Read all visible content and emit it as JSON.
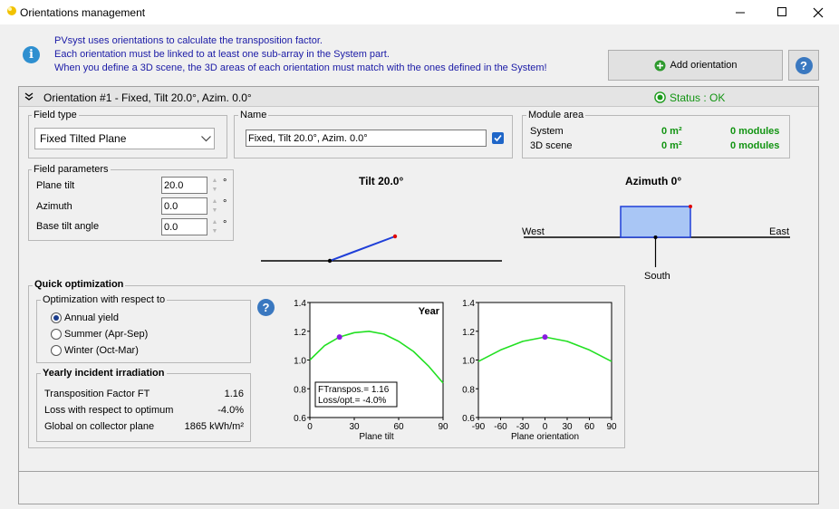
{
  "window": {
    "title": "Orientations management"
  },
  "info": {
    "lines": [
      "PVsyst uses orientations to calculate the transposition factor.",
      "Each orientation must be linked to at least one sub-array in the System part.",
      "When you define a 3D scene, the 3D areas of each orientation must match with the ones defined in the System!"
    ]
  },
  "toolbar": {
    "add_orientation": "Add orientation",
    "help": "?"
  },
  "orientation": {
    "header": "Orientation #1 - Fixed, Tilt 20.0°, Azim. 0.0°",
    "status": "Status : OK",
    "field_type": {
      "title": "Field type",
      "value": "Fixed Tilted Plane"
    },
    "name": {
      "title": "Name",
      "value": "Fixed, Tilt 20.0°, Azim. 0.0°",
      "checked": true
    },
    "module_area": {
      "title": "Module area",
      "rows": [
        {
          "label": "System",
          "area": "0 m²",
          "modules": "0 modules"
        },
        {
          "label": "3D scene",
          "area": "0 m²",
          "modules": "0 modules"
        }
      ]
    },
    "field_parameters": {
      "title": "Field parameters",
      "rows": [
        {
          "label": "Plane tilt",
          "value": "20.0",
          "unit": "°"
        },
        {
          "label": "Azimuth",
          "value": "0.0",
          "unit": "°"
        },
        {
          "label": "Base tilt angle",
          "value": "0.0",
          "unit": "°"
        }
      ]
    },
    "tilt_diagram": {
      "title": "Tilt 20.0°",
      "tilt_deg": 20
    },
    "azimuth_diagram": {
      "title": "Azimuth 0°",
      "west": "West",
      "east": "East",
      "south": "South"
    }
  },
  "quick_opt": {
    "title": "Quick optimization",
    "respect_title": "Optimization with respect to",
    "options": [
      {
        "label": "Annual yield",
        "selected": true
      },
      {
        "label": "Summer (Apr-Sep)",
        "selected": false
      },
      {
        "label": "Winter (Oct-Mar)",
        "selected": false
      }
    ],
    "yearly": {
      "title": "Yearly incident irradiation",
      "rows": [
        {
          "label": "Transposition Factor FT",
          "value": "1.16"
        },
        {
          "label": "Loss with respect to optimum",
          "value": "-4.0%"
        },
        {
          "label": "Global on collector plane",
          "value": "1865 kWh/m²"
        }
      ]
    },
    "help": "?"
  },
  "colors": {
    "curve": "#22e022",
    "point": "#8a1be0",
    "accent": "#129412",
    "tilt_line": "#1f3fd8",
    "panel_fill": "#a9c6f5"
  },
  "chart_data": [
    {
      "type": "line",
      "label": "Year",
      "xlabel": "Plane tilt",
      "ylabel": "",
      "xlim": [
        0,
        90
      ],
      "ylim": [
        0.6,
        1.4
      ],
      "xticks": [
        "0",
        "30",
        "60",
        "90"
      ],
      "yticks": [
        "0.6",
        "0.8",
        "1.0",
        "1.2",
        "1.4"
      ],
      "x": [
        0,
        10,
        20,
        30,
        40,
        50,
        60,
        70,
        80,
        90
      ],
      "values": [
        1.0,
        1.1,
        1.16,
        1.19,
        1.2,
        1.18,
        1.13,
        1.06,
        0.96,
        0.84
      ],
      "marker": {
        "x": 20,
        "y": 1.16
      },
      "annotation": [
        "FTranspos.= 1.16",
        "Loss/opt.= -4.0%"
      ]
    },
    {
      "type": "line",
      "xlabel": "Plane orientation",
      "ylabel": "",
      "xlim": [
        -90,
        90
      ],
      "ylim": [
        0.6,
        1.4
      ],
      "xticks": [
        "-90",
        "-60",
        "-30",
        "0",
        "30",
        "60",
        "90"
      ],
      "yticks": [
        "0.6",
        "0.8",
        "1.0",
        "1.2",
        "1.4"
      ],
      "x": [
        -90,
        -60,
        -30,
        0,
        30,
        60,
        90
      ],
      "values": [
        0.99,
        1.07,
        1.13,
        1.16,
        1.13,
        1.07,
        0.99
      ],
      "marker": {
        "x": 0,
        "y": 1.16
      }
    }
  ]
}
